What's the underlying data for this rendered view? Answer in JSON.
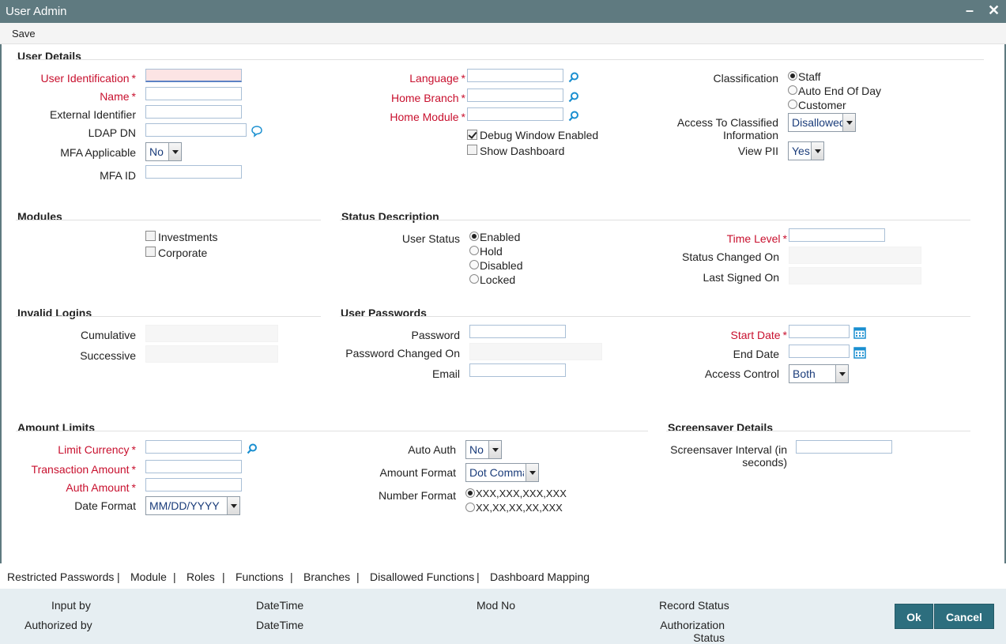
{
  "window": {
    "title": "User Admin",
    "minimize_glyph": "–",
    "close_glyph": "✕"
  },
  "menu": {
    "save": "Save"
  },
  "user_details": {
    "section_title": "User Details",
    "user_identification": {
      "label": "User Identification",
      "value": ""
    },
    "name": {
      "label": "Name",
      "value": ""
    },
    "external_identifier": {
      "label": "External Identifier",
      "value": ""
    },
    "ldap_dn": {
      "label": "LDAP DN",
      "value": ""
    },
    "mfa_applicable": {
      "label": "MFA Applicable",
      "value": "No"
    },
    "mfa_id": {
      "label": "MFA ID",
      "value": ""
    },
    "language": {
      "label": "Language",
      "value": ""
    },
    "home_branch": {
      "label": "Home Branch",
      "value": ""
    },
    "home_module": {
      "label": "Home Module",
      "value": ""
    },
    "debug_window": {
      "label": "Debug Window Enabled",
      "checked": true
    },
    "show_dashboard": {
      "label": "Show Dashboard",
      "checked": false
    },
    "classification": {
      "label": "Classification",
      "options": [
        "Staff",
        "Auto End Of Day",
        "Customer"
      ],
      "selected": "Staff"
    },
    "access_classified": {
      "label": "Access To Classified Information",
      "value": "Disallowed"
    },
    "view_pii": {
      "label": "View PII",
      "value": "Yes"
    }
  },
  "modules": {
    "section_title": "Modules",
    "investments": {
      "label": "Investments",
      "checked": false
    },
    "corporate": {
      "label": "Corporate",
      "checked": false
    }
  },
  "status_description": {
    "section_title": "Status Description",
    "user_status": {
      "label": "User Status",
      "options": [
        "Enabled",
        "Hold",
        "Disabled",
        "Locked"
      ],
      "selected": "Enabled"
    },
    "time_level": {
      "label": "Time Level",
      "value": ""
    },
    "status_changed_on": {
      "label": "Status Changed On",
      "value": ""
    },
    "last_signed_on": {
      "label": "Last Signed On",
      "value": ""
    }
  },
  "invalid_logins": {
    "section_title": "Invalid Logins",
    "cumulative": {
      "label": "Cumulative",
      "value": ""
    },
    "successive": {
      "label": "Successive",
      "value": ""
    }
  },
  "user_passwords": {
    "section_title": "User Passwords",
    "password": {
      "label": "Password",
      "value": ""
    },
    "password_changed_on": {
      "label": "Password Changed On",
      "value": ""
    },
    "email": {
      "label": "Email",
      "value": ""
    },
    "start_date": {
      "label": "Start Date",
      "value": ""
    },
    "end_date": {
      "label": "End Date",
      "value": ""
    },
    "access_control": {
      "label": "Access Control",
      "value": "Both"
    }
  },
  "amount_limits": {
    "section_title": "Amount Limits",
    "limit_currency": {
      "label": "Limit Currency",
      "value": ""
    },
    "transaction_amount": {
      "label": "Transaction Amount",
      "value": ""
    },
    "auth_amount": {
      "label": "Auth Amount",
      "value": ""
    },
    "date_format": {
      "label": "Date Format",
      "value": "MM/DD/YYYY"
    },
    "auto_auth": {
      "label": "Auto Auth",
      "value": "No"
    },
    "amount_format": {
      "label": "Amount Format",
      "value": "Dot Comma"
    },
    "number_format": {
      "label": "Number Format",
      "options": [
        "XXX,XXX,XXX,XXX",
        "XX,XX,XX,XX,XXX"
      ],
      "selected": "XXX,XXX,XXX,XXX"
    }
  },
  "screensaver": {
    "section_title": "Screensaver Details",
    "interval": {
      "label": "Screensaver Interval (in seconds)",
      "value": ""
    }
  },
  "required_mark": "*",
  "tabs": [
    "Restricted Passwords",
    "Module",
    "Roles",
    "Functions",
    "Branches",
    "Disallowed Functions",
    "Dashboard Mapping"
  ],
  "tab_separator": "|",
  "footer": {
    "input_by": "Input by",
    "authorized_by": "Authorized by",
    "datetime_1": "DateTime",
    "datetime_2": "DateTime",
    "mod_no": "Mod No",
    "record_status": "Record Status",
    "authorization_status": "Authorization Status",
    "ok": "Ok",
    "cancel": "Cancel"
  },
  "colors": {
    "titlebar": "#5f7a80",
    "required": "#c8102e",
    "button": "#2d6e7e",
    "footer": "#e6eef2"
  }
}
